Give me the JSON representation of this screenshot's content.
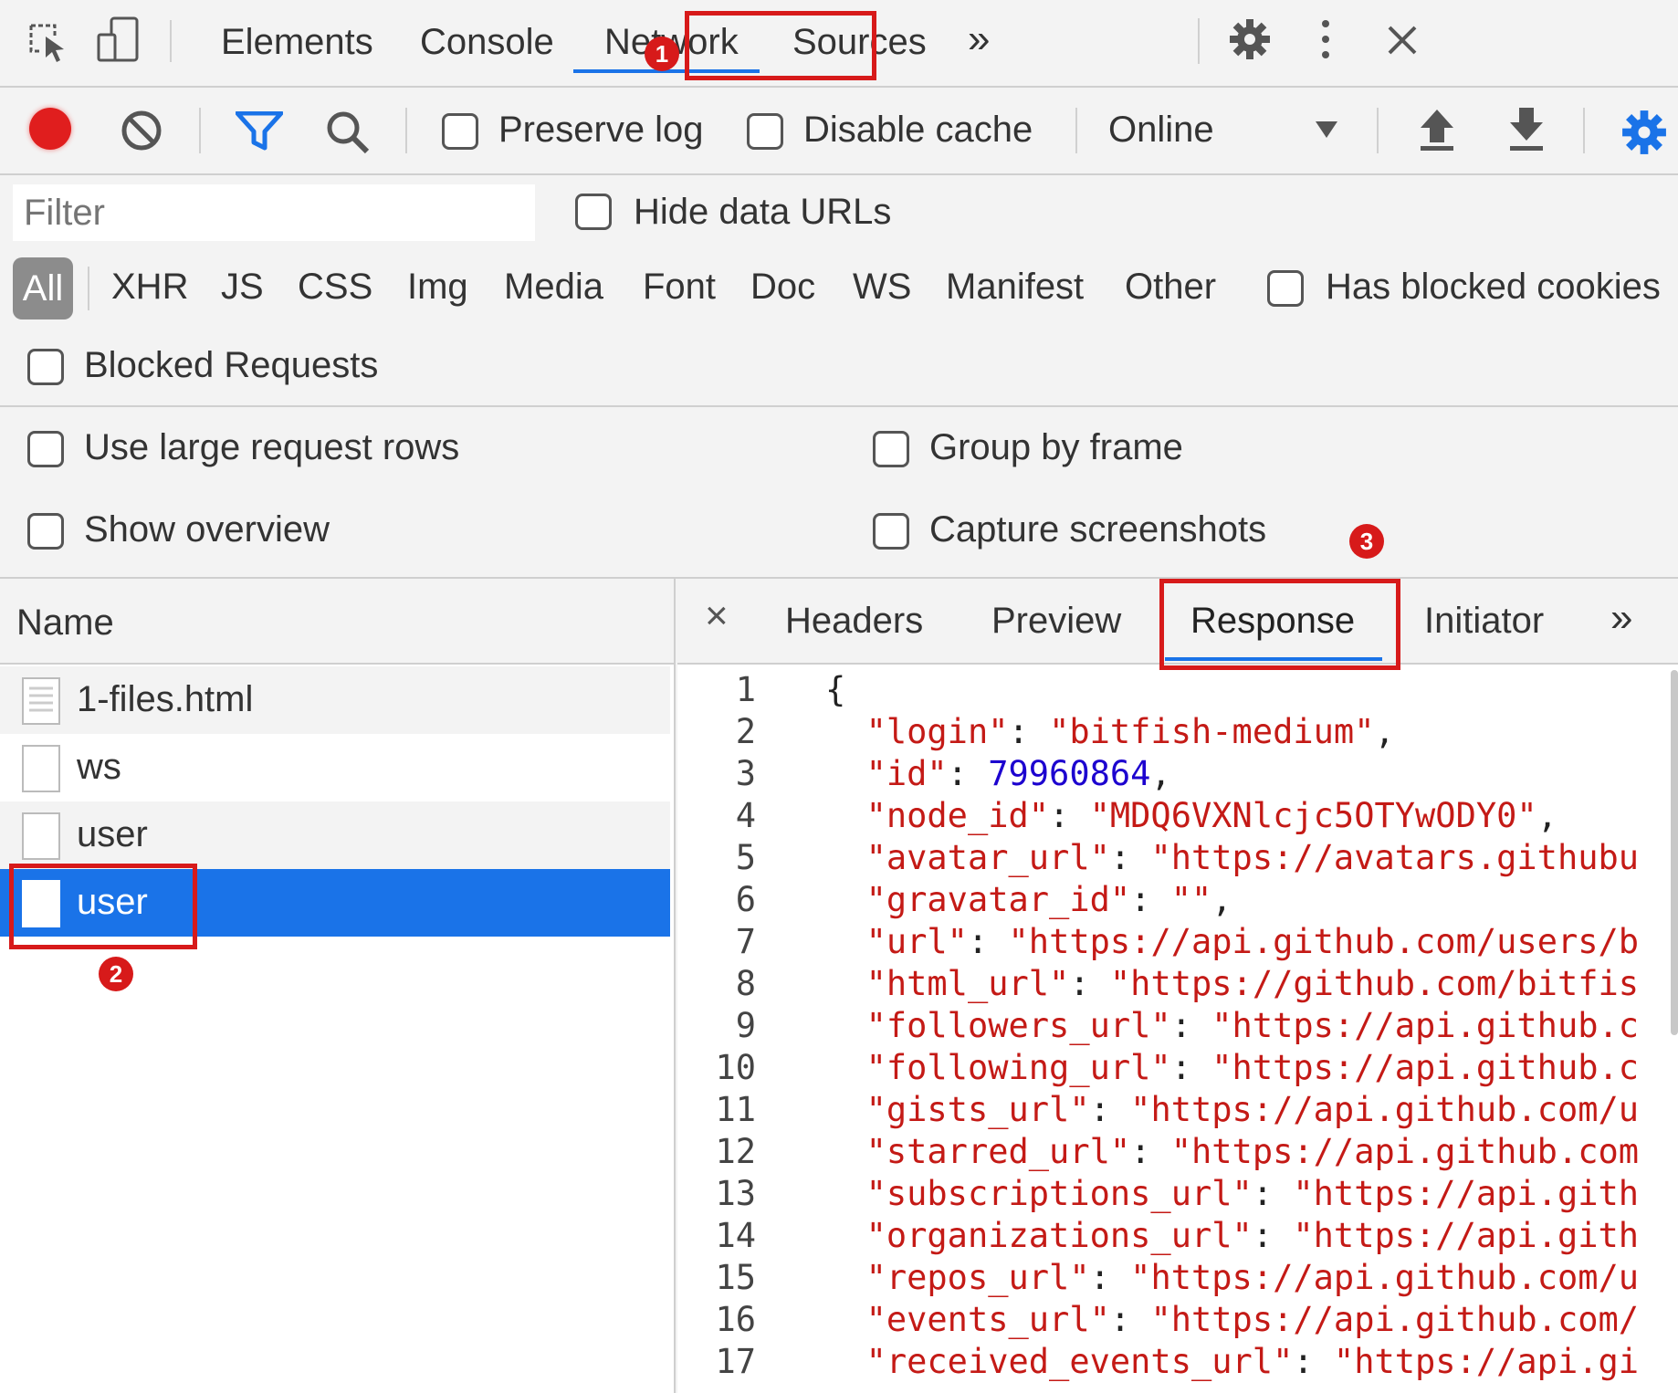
{
  "main_tabs": [
    "Elements",
    "Console",
    "Network",
    "Sources"
  ],
  "more_tabs_glyph": "»",
  "toolbar": {
    "preserve_log": "Preserve log",
    "disable_cache": "Disable cache",
    "throttle": "Online"
  },
  "filter": {
    "placeholder": "Filter",
    "hide_data_urls": "Hide data URLs",
    "types": [
      "All",
      "XHR",
      "JS",
      "CSS",
      "Img",
      "Media",
      "Font",
      "Doc",
      "WS",
      "Manifest",
      "Other"
    ],
    "has_blocked_cookies": "Has blocked cookies",
    "blocked_requests": "Blocked Requests"
  },
  "settings": {
    "large_rows": "Use large request rows",
    "group_by_frame": "Group by frame",
    "show_overview": "Show overview",
    "capture_screenshots": "Capture screenshots"
  },
  "requests": {
    "header": "Name",
    "rows": [
      "1-files.html",
      "ws",
      "user",
      "user"
    ]
  },
  "detail_tabs": [
    "Headers",
    "Preview",
    "Response",
    "Initiator"
  ],
  "close_glyph": "×",
  "badges": [
    "1",
    "2",
    "3"
  ],
  "colors": {
    "accent": "#1a73e8",
    "selected_row": "#1a73e8",
    "annotation": "#d71a1a",
    "record": "#e01e1e",
    "string": "#c41a16",
    "number": "#1c00cf"
  },
  "response_lines": [
    {
      "n": "1",
      "key": "",
      "value": "",
      "raw": "{"
    },
    {
      "n": "2",
      "key": "\"login\"",
      "value": "\"bitfish-medium\"",
      "tail": ","
    },
    {
      "n": "3",
      "key": "\"id\"",
      "value": "79960864",
      "tail": ",",
      "num": true
    },
    {
      "n": "4",
      "key": "\"node_id\"",
      "value": "\"MDQ6VXNlcjc5OTYwODY0\"",
      "tail": ","
    },
    {
      "n": "5",
      "key": "\"avatar_url\"",
      "value": "\"https://avatars.githubu",
      "tail": ""
    },
    {
      "n": "6",
      "key": "\"gravatar_id\"",
      "value": "\"\"",
      "tail": ","
    },
    {
      "n": "7",
      "key": "\"url\"",
      "value": "\"https://api.github.com/users/b",
      "tail": ""
    },
    {
      "n": "8",
      "key": "\"html_url\"",
      "value": "\"https://github.com/bitfis",
      "tail": ""
    },
    {
      "n": "9",
      "key": "\"followers_url\"",
      "value": "\"https://api.github.c",
      "tail": ""
    },
    {
      "n": "10",
      "key": "\"following_url\"",
      "value": "\"https://api.github.c",
      "tail": ""
    },
    {
      "n": "11",
      "key": "\"gists_url\"",
      "value": "\"https://api.github.com/u",
      "tail": ""
    },
    {
      "n": "12",
      "key": "\"starred_url\"",
      "value": "\"https://api.github.com",
      "tail": ""
    },
    {
      "n": "13",
      "key": "\"subscriptions_url\"",
      "value": "\"https://api.gith",
      "tail": ""
    },
    {
      "n": "14",
      "key": "\"organizations_url\"",
      "value": "\"https://api.gith",
      "tail": ""
    },
    {
      "n": "15",
      "key": "\"repos_url\"",
      "value": "\"https://api.github.com/u",
      "tail": ""
    },
    {
      "n": "16",
      "key": "\"events_url\"",
      "value": "\"https://api.github.com/",
      "tail": ""
    },
    {
      "n": "17",
      "key": "\"received_events_url\"",
      "value": "\"https://api.gi",
      "tail": ""
    }
  ]
}
